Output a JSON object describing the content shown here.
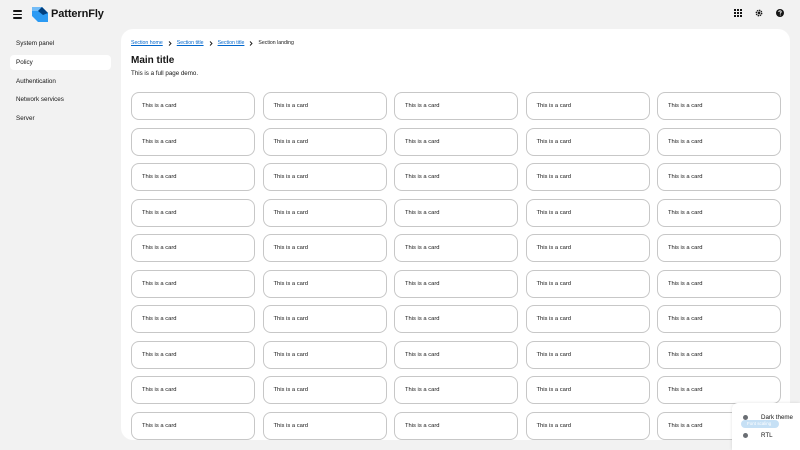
{
  "masthead": {
    "brand_name": "PatternFly",
    "tools": [
      {
        "icon": "grid-icon"
      },
      {
        "icon": "gear-icon"
      },
      {
        "icon": "help-icon"
      }
    ]
  },
  "sidebar": {
    "items": [
      {
        "label": "System panel",
        "active": false
      },
      {
        "label": "Policy",
        "active": true
      },
      {
        "label": "Authentication",
        "active": false
      },
      {
        "label": "Network services",
        "active": false
      },
      {
        "label": "Server",
        "active": false
      }
    ]
  },
  "breadcrumb": {
    "links": [
      "Section home",
      "Section title",
      "Section title"
    ],
    "current": "Section landing"
  },
  "main": {
    "title": "Main title",
    "description": "This is a full page demo.",
    "card_text": "This is a card",
    "card_rows": 10,
    "card_cols": 5
  },
  "theme_switcher": {
    "dark_theme_label": "Dark theme",
    "pill_label": "Font scaling",
    "rtl_label": "RTL"
  },
  "colors": {
    "link": "#0066cc",
    "background": "#f2f2f2",
    "surface": "#ffffff",
    "card_border": "#c7c7c7",
    "logo": "#2b9af3"
  }
}
